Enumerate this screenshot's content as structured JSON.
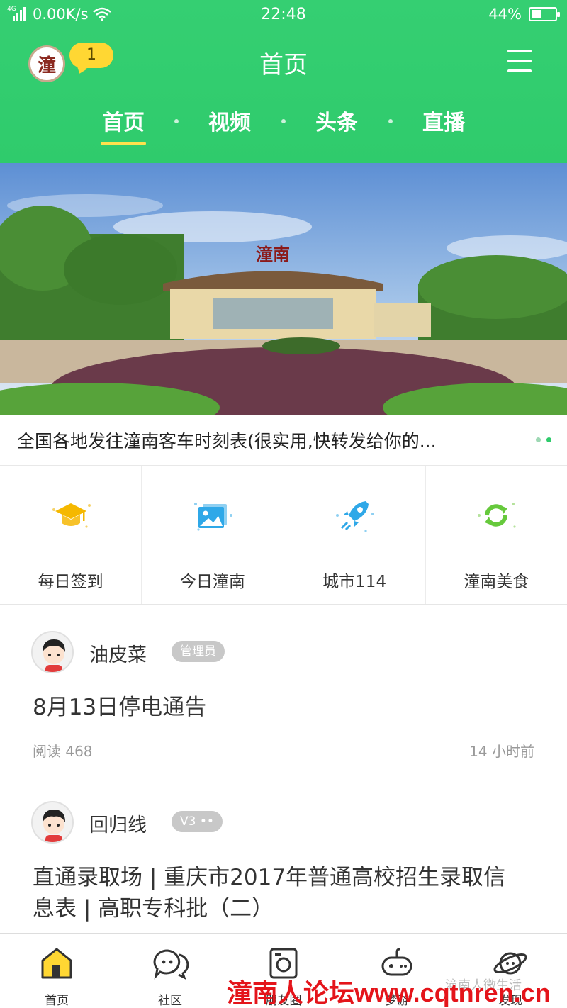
{
  "status_bar": {
    "network": "4G",
    "speed": "0.00K/s",
    "time": "22:48",
    "battery": "44%",
    "battery_level": 0.44
  },
  "app_bar": {
    "logo_text": "潼",
    "notification_count": "1",
    "title": "首页"
  },
  "tabs": [
    {
      "label": "首页",
      "active": true
    },
    {
      "label": "视频",
      "active": false
    },
    {
      "label": "头条",
      "active": false
    },
    {
      "label": "直播",
      "active": false
    }
  ],
  "banner": {
    "sign_text": "潼南",
    "caption": "全国各地发往潼南客车时刻表(很实用,快转发给你的...",
    "slide_count": 2,
    "active_slide": 2
  },
  "quick_links": [
    {
      "label": "每日签到",
      "icon": "graduation-cap-icon",
      "color": "#f5b800"
    },
    {
      "label": "今日潼南",
      "icon": "image-icon",
      "color": "#2fa8e8"
    },
    {
      "label": "城市114",
      "icon": "rocket-icon",
      "color": "#2fa8e8"
    },
    {
      "label": "潼南美食",
      "icon": "refresh-icon",
      "color": "#66c93c"
    }
  ],
  "posts": [
    {
      "author": "油皮菜",
      "badge": "管理员",
      "title": "8月13日停电通告",
      "reads": "阅读 468",
      "time": "14 小时前"
    },
    {
      "author": "回归线",
      "badge": "V3 ••",
      "title": "直通录取场 | 重庆市2017年普通高校招生录取信息表 | 高职专科批（二）"
    }
  ],
  "bottom_nav": [
    {
      "label": "首页",
      "icon": "home-icon"
    },
    {
      "label": "社区",
      "icon": "chat-bubbles-icon"
    },
    {
      "label": "朋友圈",
      "icon": "camera-icon"
    },
    {
      "label": "梦游",
      "icon": "gamepad-icon"
    },
    {
      "label": "发现",
      "icon": "planet-icon"
    }
  ],
  "watermark": {
    "text": "潼南人论坛www.cqtnren.cn",
    "sub": "潼南人微生活"
  },
  "colors": {
    "brand_green": "#2fcb6c",
    "tab_underline": "#ffe14d",
    "badge_yellow": "#ffd733",
    "watermark_red": "#e4141a"
  }
}
